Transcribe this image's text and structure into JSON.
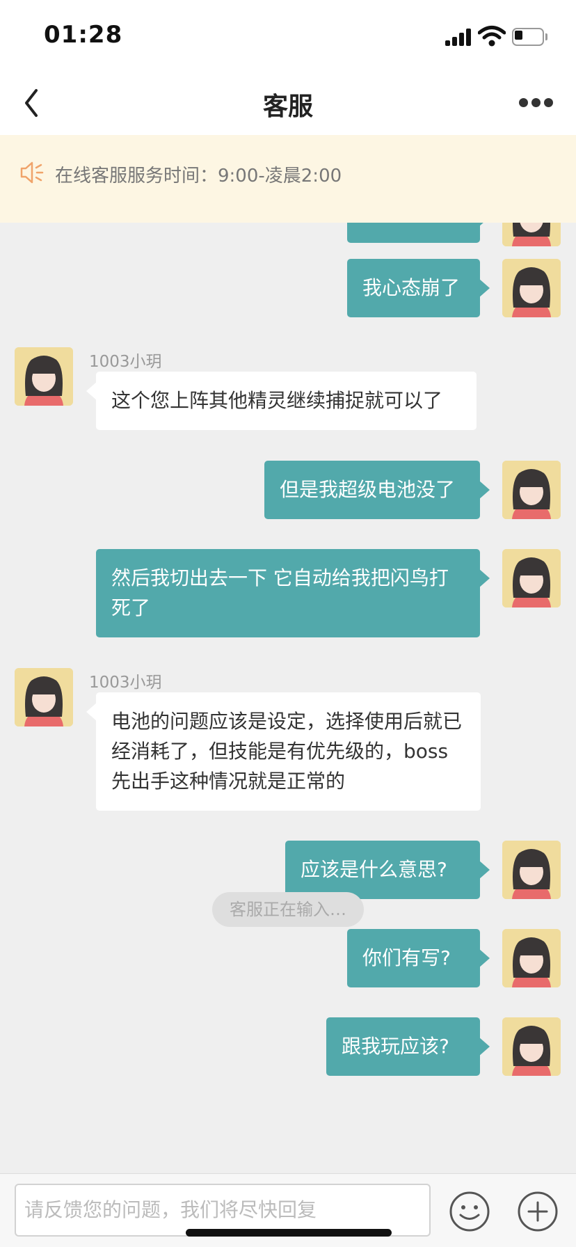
{
  "status_bar": {
    "time": "01:28"
  },
  "nav": {
    "title": "客服"
  },
  "notice": {
    "text": "在线客服服务时间：9:00-凌晨2:00"
  },
  "chat": {
    "messages": [
      {
        "side": "out",
        "text": "我心态崩了"
      },
      {
        "side": "in",
        "sender": "1003小玥",
        "text": "这个您上阵其他精灵继续捕捉就可以了"
      },
      {
        "side": "out",
        "text": "但是我超级电池没了"
      },
      {
        "side": "out",
        "text": "然后我切出去一下 它自动给我把闪鸟打死了"
      },
      {
        "side": "in",
        "sender": "1003小玥",
        "text": "电池的问题应该是设定，选择使用后就已经消耗了，但技能是有优先级的，boss先出手这种情况就是正常的"
      },
      {
        "side": "out",
        "text": "应该是什么意思?"
      },
      {
        "side": "out",
        "text": "你们有写?"
      },
      {
        "side": "out",
        "text": "跟我玩应该?"
      }
    ],
    "typing": "客服正在输入…"
  },
  "input": {
    "placeholder": "请反馈您的问题，我们将尽快回复"
  },
  "colors": {
    "bubble_out": "#52a9ab",
    "notice_bg": "#fdf6e3",
    "notice_icon": "#f0a36a"
  },
  "icons": [
    "back-arrow-icon",
    "more-icon",
    "speaker-icon",
    "emoji-icon",
    "plus-icon"
  ]
}
